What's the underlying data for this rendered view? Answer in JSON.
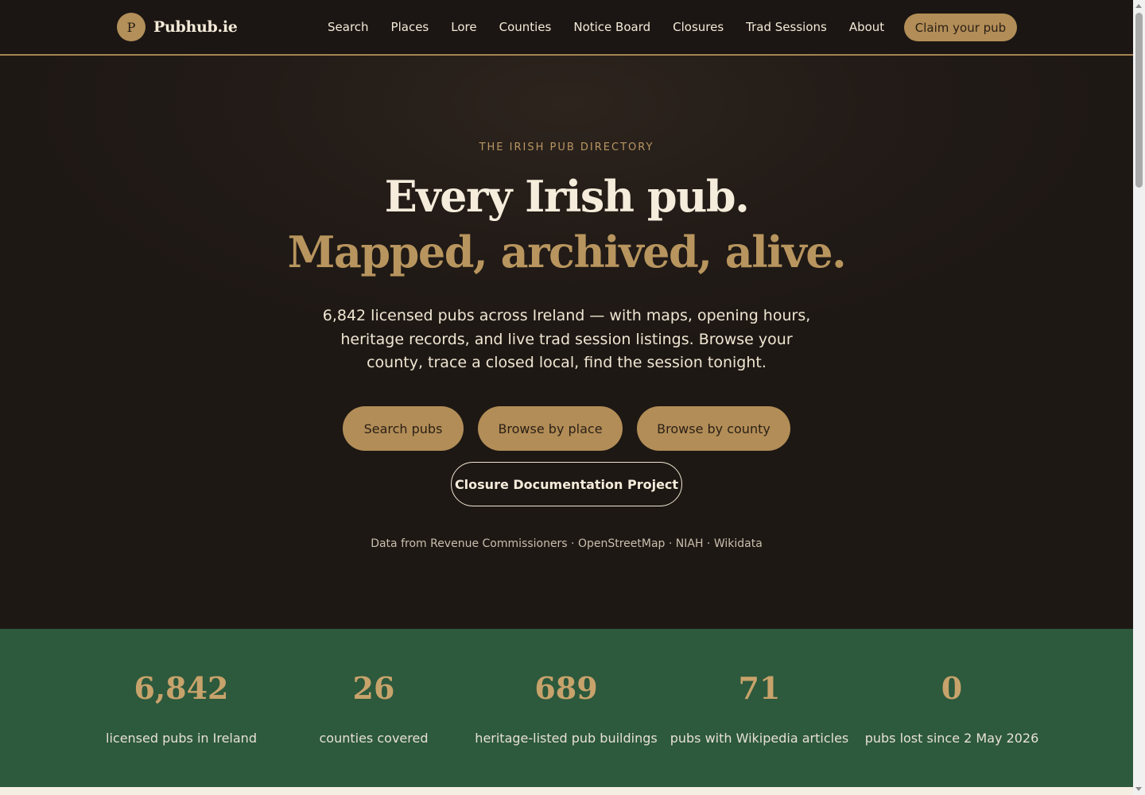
{
  "nav": {
    "logo_mark": "P",
    "logo_text": "Pubhub.ie",
    "links": [
      "Search",
      "Places",
      "Lore",
      "Counties",
      "Notice Board",
      "Closures",
      "Trad Sessions",
      "About"
    ],
    "cta_label": "Claim your pub"
  },
  "hero": {
    "eyebrow": "THE IRISH PUB DIRECTORY",
    "headline_line1": "Every Irish pub.",
    "headline_line2": "Mapped, archived, alive.",
    "lead": "6,842 licensed pubs across Ireland — with maps, opening hours, heritage records, and live trad session listings. Browse your county, trace a closed local, find the session tonight.",
    "buttons": {
      "search": "Search pubs",
      "place": "Browse by place",
      "county": "Browse by county",
      "closure": "Closure Documentation Project"
    },
    "sources": "Data from Revenue Commissioners · OpenStreetMap · NIAH · Wikidata"
  },
  "stats": [
    {
      "value": "6,842",
      "label": "licensed pubs in Ireland"
    },
    {
      "value": "26",
      "label": "counties covered"
    },
    {
      "value": "689",
      "label": "heritage-listed pub buildings"
    },
    {
      "value": "71",
      "label": "pubs with Wikipedia articles"
    },
    {
      "value": "0",
      "label": "pubs lost since 2 May 2026"
    }
  ],
  "colors": {
    "accent": "#b28d57",
    "nav_bg": "#1b1613",
    "hero_bg": "#221b17",
    "stats_bg": "#2d593d"
  }
}
